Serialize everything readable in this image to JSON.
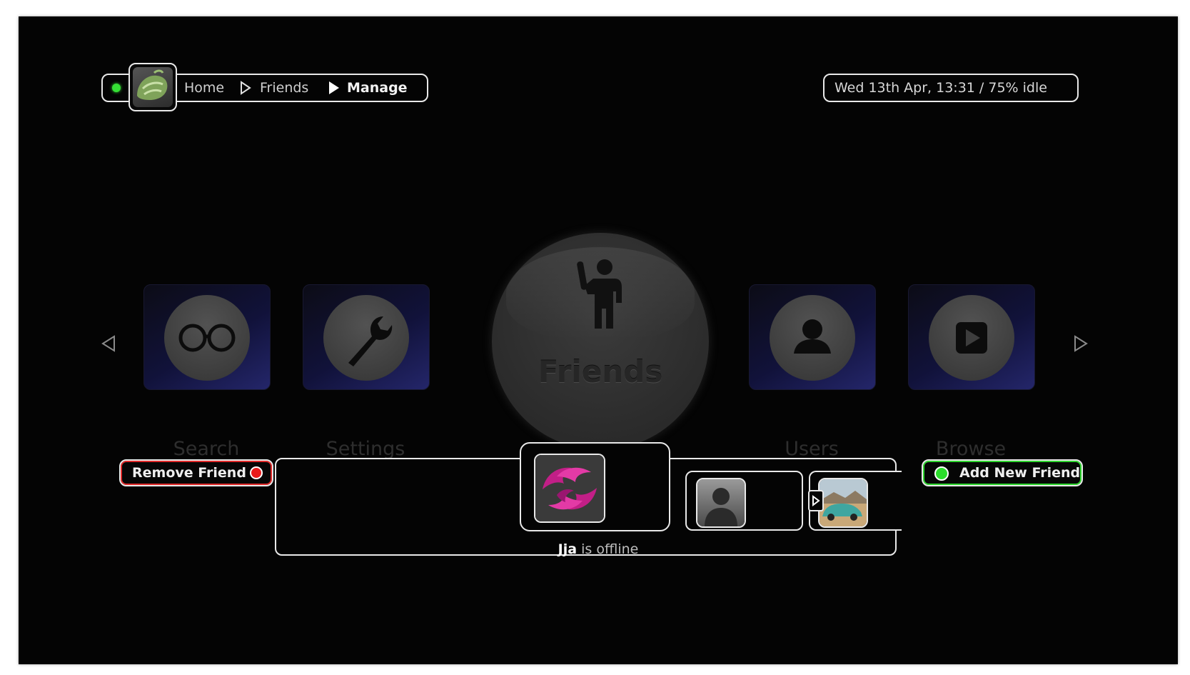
{
  "header": {
    "breadcrumb": [
      "Home",
      "Friends",
      "Manage"
    ],
    "clock": "Wed 13th Apr, 13:31 / 75% idle",
    "status_color": "#35e035"
  },
  "menu": {
    "items": [
      {
        "label": "Search",
        "icon": "glasses-icon"
      },
      {
        "label": "Settings",
        "icon": "wrench-icon"
      },
      {
        "label": "Friends",
        "icon": "waving-person-icon",
        "selected": true
      },
      {
        "label": "Users",
        "icon": "user-icon"
      },
      {
        "label": "Browse",
        "icon": "play-icon"
      }
    ]
  },
  "actions": {
    "remove_label": "Remove Friend",
    "remove_color": "#e81b1b",
    "add_label": "Add New Friend",
    "add_color": "#2bdc2b"
  },
  "friends": {
    "selected_name": "Jja",
    "selected_status": " is offline",
    "avatars": [
      "pink-flames-avatar",
      "generic-person-avatar",
      "car-photo-avatar"
    ]
  }
}
